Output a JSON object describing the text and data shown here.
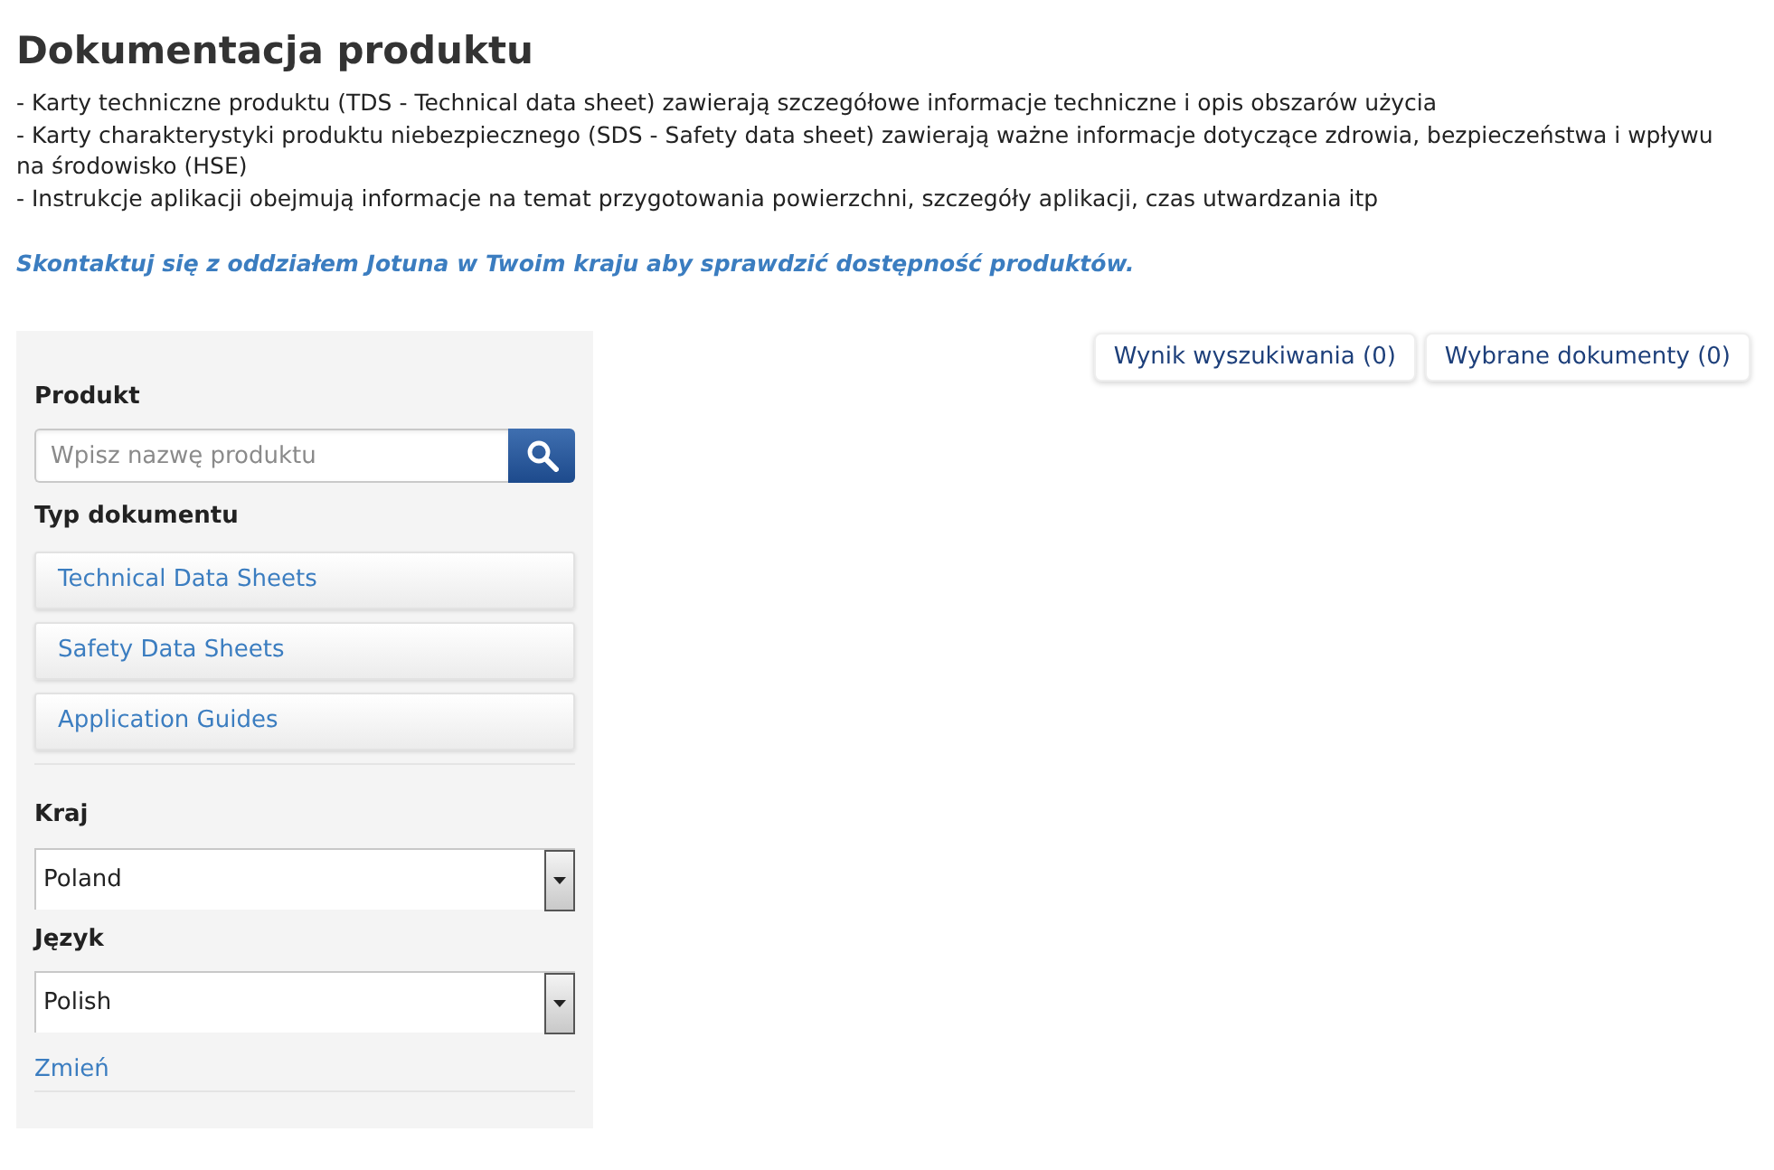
{
  "page": {
    "title": "Dokumentacja produktu",
    "description_lines": [
      "- Karty techniczne produktu (TDS - Technical data sheet) zawierają szczegółowe informacje techniczne i opis obszarów użycia",
      "- Karty charakterystyki produktu niebezpiecznego (SDS - Safety data sheet) zawierają ważne informacje dotyczące zdrowia, bezpieczeństwa i wpływu na środowisko (HSE)",
      "- Instrukcje aplikacji obejmują informacje na temat przygotowania powierzchni, szczegóły aplikacji, czas utwardzania itp"
    ],
    "contact_link": "Skontaktuj się z oddziałem Jotuna w Twoim kraju aby sprawdzić dostępność produktów."
  },
  "sidebar": {
    "product": {
      "label": "Produkt",
      "search": {
        "placeholder": "Wpisz nazwę produktu"
      }
    },
    "document_type": {
      "label": "Typ dokumentu",
      "options": [
        {
          "label": "Technical Data Sheets"
        },
        {
          "label": "Safety Data Sheets"
        },
        {
          "label": "Application Guides"
        }
      ]
    },
    "country": {
      "label": "Kraj",
      "value": "Poland"
    },
    "language": {
      "label": "Język",
      "value": "Polish"
    },
    "change_link": "Zmień"
  },
  "result_tabs": [
    {
      "label": "Wynik wyszukiwania (0)"
    },
    {
      "label": "Wybrane dokumenty (0)"
    }
  ]
}
